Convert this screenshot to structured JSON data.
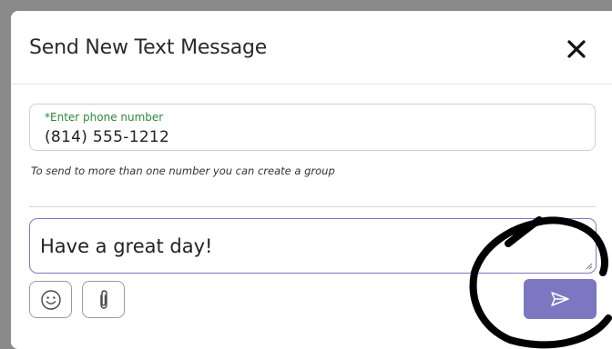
{
  "modal": {
    "title": "Send New Text Message"
  },
  "phone": {
    "label": "*Enter phone number",
    "value": "(814) 555-1212"
  },
  "helper_text": "To send to more than one number you can create a group",
  "message": {
    "value": "Have a great day!"
  },
  "icons": {
    "close": "close-icon",
    "emoji": "emoji-icon",
    "attach": "paperclip-icon",
    "send": "send-icon",
    "resize": "resize-grip-icon"
  },
  "colors": {
    "accent": "#7b78c1",
    "label_green": "#2c8a3a",
    "message_border": "#7d78c2",
    "annotation_ink": "#000000"
  }
}
